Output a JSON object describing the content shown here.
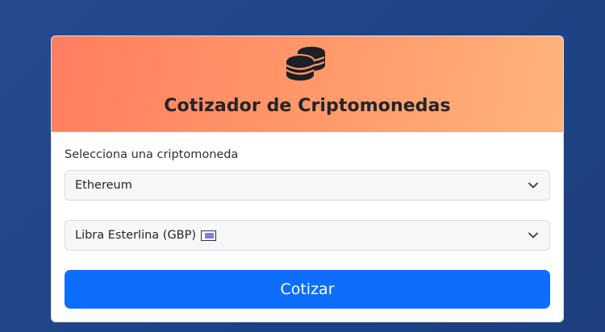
{
  "header": {
    "title": "Cotizador de Criptomonedas",
    "icon": "coins-icon"
  },
  "form": {
    "crypto_label": "Selecciona una criptomoneda",
    "crypto_select": {
      "selected": "Ethereum"
    },
    "currency_select": {
      "selected": "Libra Esterlina (GBP)",
      "flag_icon": "uk-flag-icon"
    },
    "submit_label": "Cotizar"
  },
  "colors": {
    "background": "#234689",
    "header_gradient_start": "#ff7e5f",
    "header_gradient_end": "#feb47b",
    "button": "#0d6efd",
    "select_bg": "#f6f7f9"
  }
}
